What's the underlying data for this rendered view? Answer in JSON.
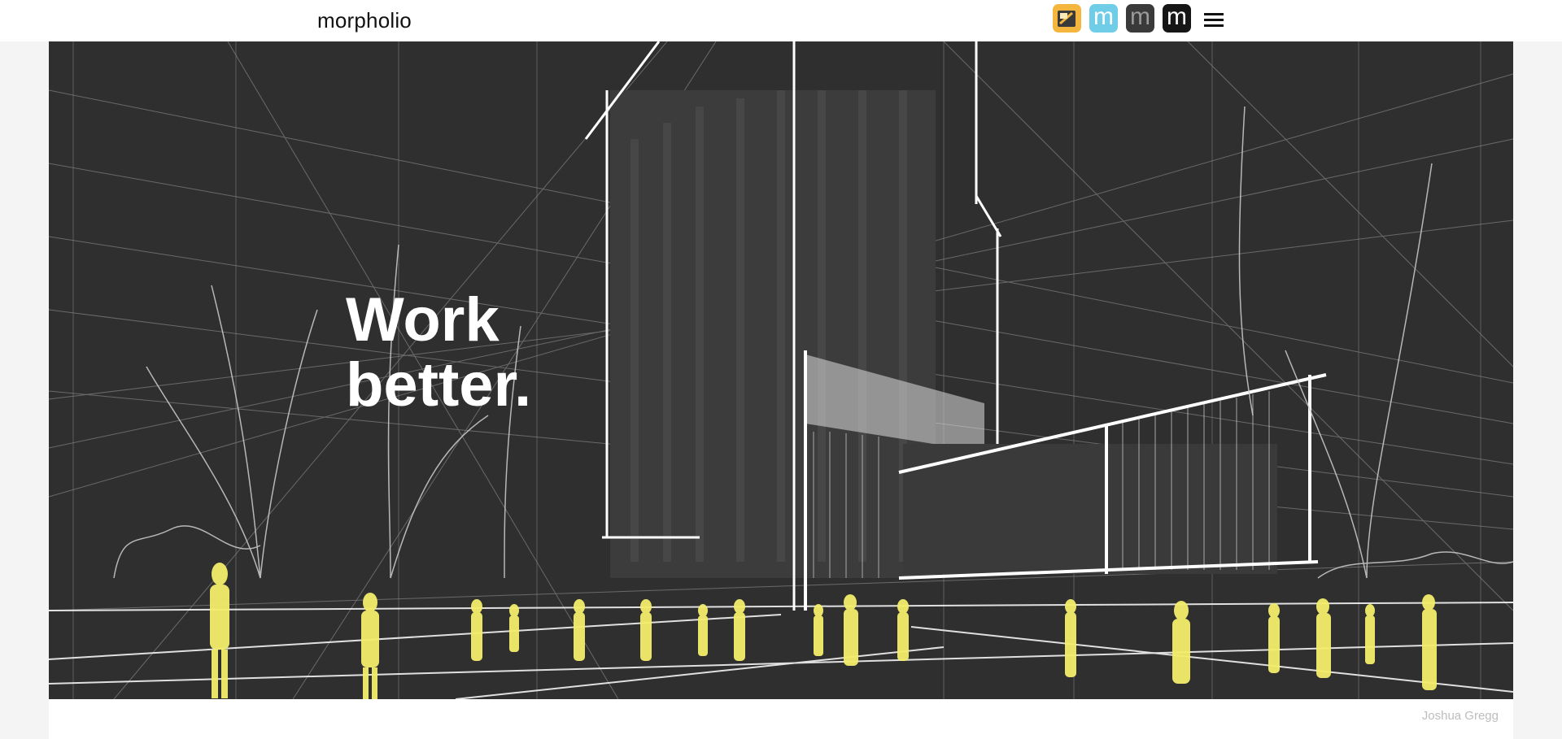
{
  "brand": {
    "name": "morpholio"
  },
  "header": {
    "apps": [
      {
        "icon": "trace-app-icon",
        "bg": "#f4b63c",
        "glyph": ""
      },
      {
        "icon": "m-app-icon-blue",
        "bg": "#6fcde8",
        "glyph": "m",
        "fg": "#ffffff"
      },
      {
        "icon": "m-app-icon-gray",
        "bg": "#3a3a3a",
        "glyph": "m",
        "fg": "#9a9a9a"
      },
      {
        "icon": "m-app-icon-black",
        "bg": "#161616",
        "glyph": "m",
        "fg": "#ffffff"
      }
    ],
    "menu_icon": "hamburger-menu-icon"
  },
  "hero": {
    "headline_line1": "Work",
    "headline_line2": "better.",
    "background": "#2f2f2f",
    "figure_color": "#f3ee6a"
  },
  "credit": "Joshua Gregg"
}
